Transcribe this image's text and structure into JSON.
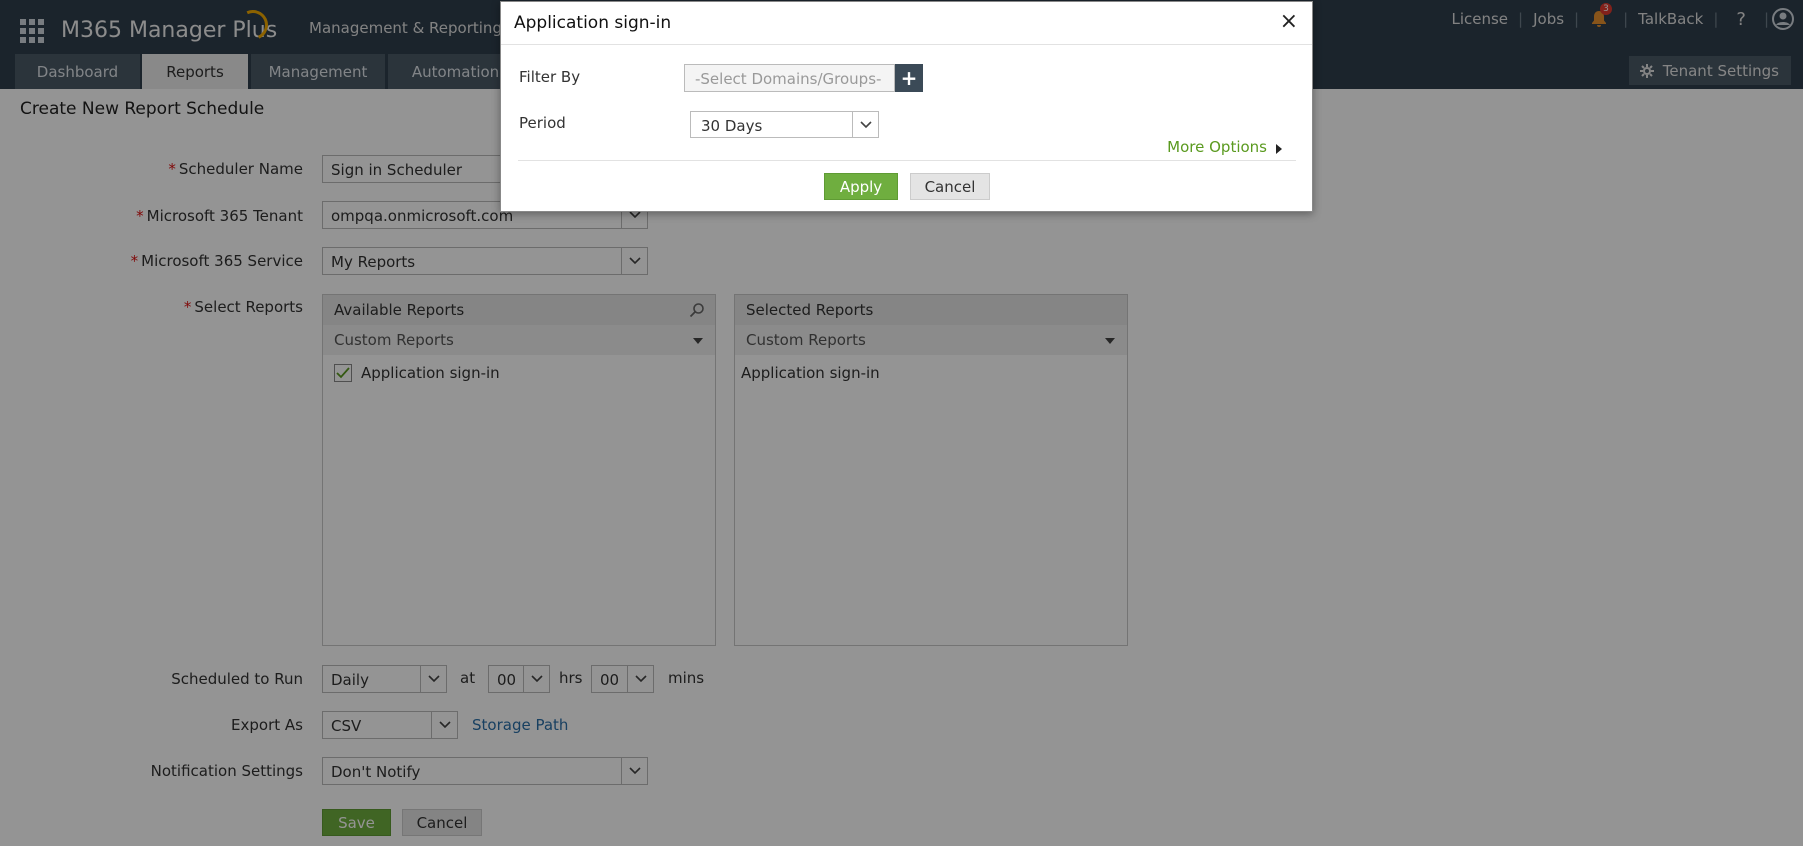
{
  "topbar": {
    "brand": "M365 Manager Plus",
    "menu": "Management & Reporting",
    "links": [
      "License",
      "Jobs"
    ],
    "notification_count": "3",
    "talkback": "TalkBack",
    "help": "?"
  },
  "nav": {
    "tabs": [
      "Dashboard",
      "Reports",
      "Management",
      "Automation"
    ],
    "active": "Reports",
    "tenant_settings": "Tenant Settings"
  },
  "page": {
    "title": "Create New Report Schedule",
    "scheduler_name_label": "Scheduler Name",
    "scheduler_name_value": "Sign in Scheduler",
    "tenant_label": "Microsoft 365 Tenant",
    "tenant_value": "ompqa.onmicrosoft.com",
    "service_label": "Microsoft 365 Service",
    "service_value": "My Reports",
    "select_reports_label": "Select Reports",
    "available": {
      "header": "Available Reports",
      "category": "Custom Reports",
      "items": [
        {
          "label": "Application sign-in",
          "checked": true
        }
      ]
    },
    "selected": {
      "header": "Selected Reports",
      "category": "Custom Reports",
      "items": [
        {
          "label": "Application sign-in"
        }
      ]
    },
    "schedule_label": "Scheduled to Run",
    "schedule_value": "Daily",
    "at_text": "at",
    "hours_value": "00",
    "hrs_text": "hrs",
    "mins_value": "00",
    "mins_text": "mins",
    "export_label": "Export As",
    "export_value": "CSV",
    "storage_path": "Storage Path",
    "notification_label": "Notification Settings",
    "notification_value": "Don't Notify",
    "save": "Save",
    "cancel": "Cancel"
  },
  "modal": {
    "title": "Application sign-in",
    "close": "×",
    "filter_label": "Filter By",
    "filter_placeholder": "-Select Domains/Groups-",
    "period_label": "Period",
    "period_value": "30 Days",
    "more_options": "More Options",
    "apply": "Apply",
    "cancel": "Cancel"
  },
  "colors": {
    "header_bg": "#2f3f4d",
    "accent_green": "#6fae3f",
    "link_blue": "#2a6fa8",
    "required_red": "#dd1111"
  }
}
